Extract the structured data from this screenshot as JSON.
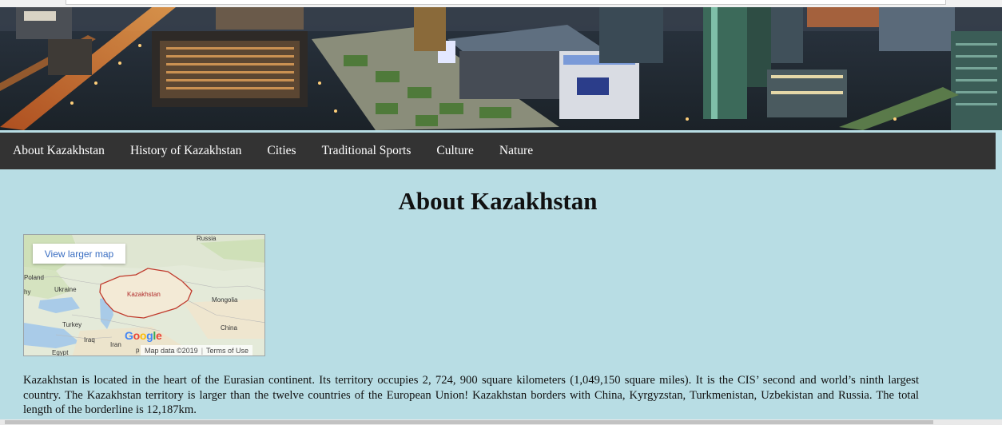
{
  "nav": {
    "items": [
      {
        "label": "About Kazakhstan"
      },
      {
        "label": "History of Kazakhstan"
      },
      {
        "label": "Cities"
      },
      {
        "label": "Traditional Sports"
      },
      {
        "label": "Culture"
      },
      {
        "label": "Nature"
      }
    ]
  },
  "page": {
    "title": "About Kazakhstan",
    "intro": "Kazakhstan is located in the heart of the Eurasian continent. Its territory occupies 2, 724, 900 square kilometers (1,049,150 square miles). It is the CIS’ second and world’s ninth largest country. The Kazakhstan territory is larger than the twelve countries of the European Union! Kazakhstan borders with China, Kyrgyzstan, Turkmenistan, Uzbekistan and Russia. The total length of the borderline is 12,187km."
  },
  "map": {
    "larger_map_link": "View larger map",
    "labels": {
      "russia": "Russia",
      "poland": "Poland",
      "ukraine": "Ukraine",
      "kazakhstan": "Kazakhstan",
      "mongolia": "Mongolia",
      "turkey": "Turkey",
      "china": "China",
      "iraq": "Iraq",
      "iran": "Iran",
      "egypt": "Egypt",
      "edge_left": "hy",
      "edge_bottom": "p"
    },
    "logo": "Google",
    "map_data": "Map data ©2019",
    "terms": "Terms of Use"
  },
  "colors": {
    "page_background": "#b8dde4",
    "nav_background": "#333333",
    "nav_text": "#ffffff",
    "kazakhstan_border": "#c0392b",
    "map_link": "#3a6ec2"
  }
}
